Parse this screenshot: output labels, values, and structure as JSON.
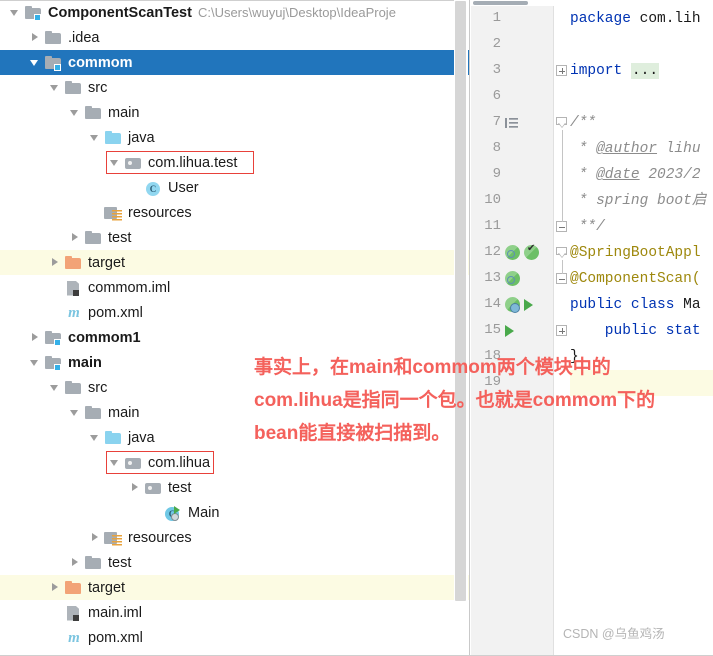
{
  "project_tree": {
    "scrollbar": {
      "visible": true
    },
    "rows": [
      {
        "indent": 0,
        "twisty": "expanded",
        "icon": "module-folder-icon",
        "label": "ComponentScanTest",
        "bold": true,
        "subpath": "C:\\Users\\wuyuj\\Desktop\\IdeaProje",
        "state": "normal",
        "name": "tree-row-componentscantest"
      },
      {
        "indent": 1,
        "twisty": "collapsed",
        "icon": "folder-icon",
        "label": ".idea",
        "bold": false,
        "subpath": "",
        "state": "normal",
        "name": "tree-row-idea"
      },
      {
        "indent": 1,
        "twisty": "expanded",
        "icon": "module-folder-icon",
        "label": "commom",
        "bold": true,
        "subpath": "",
        "state": "selected",
        "name": "tree-row-commom"
      },
      {
        "indent": 2,
        "twisty": "expanded",
        "icon": "folder-icon",
        "label": "src",
        "bold": false,
        "subpath": "",
        "state": "normal",
        "name": "tree-row-commom-src"
      },
      {
        "indent": 3,
        "twisty": "expanded",
        "icon": "folder-icon",
        "label": "main",
        "bold": false,
        "subpath": "",
        "state": "normal",
        "name": "tree-row-commom-src-main"
      },
      {
        "indent": 4,
        "twisty": "expanded",
        "icon": "source-folder-icon",
        "label": "java",
        "bold": false,
        "subpath": "",
        "state": "normal",
        "name": "tree-row-commom-java"
      },
      {
        "indent": 5,
        "twisty": "expanded",
        "icon": "package-icon",
        "label": "com.lihua.test",
        "bold": false,
        "subpath": "",
        "state": "normal",
        "name": "tree-row-package-com-lihua-test"
      },
      {
        "indent": 6,
        "twisty": "none",
        "icon": "java-class-icon",
        "label": "User",
        "bold": false,
        "subpath": "",
        "state": "normal",
        "name": "tree-row-class-user"
      },
      {
        "indent": 4,
        "twisty": "none",
        "icon": "resources-folder-icon",
        "label": "resources",
        "bold": false,
        "subpath": "",
        "state": "normal",
        "name": "tree-row-commom-resources"
      },
      {
        "indent": 3,
        "twisty": "collapsed",
        "icon": "folder-icon",
        "label": "test",
        "bold": false,
        "subpath": "",
        "state": "normal",
        "name": "tree-row-commom-test"
      },
      {
        "indent": 2,
        "twisty": "collapsed",
        "icon": "target-folder-icon",
        "label": "target",
        "bold": false,
        "subpath": "",
        "state": "excluded",
        "name": "tree-row-commom-target"
      },
      {
        "indent": 2,
        "twisty": "none",
        "icon": "iml-file-icon",
        "label": "commom.iml",
        "bold": false,
        "subpath": "",
        "state": "normal",
        "name": "tree-row-commom-iml"
      },
      {
        "indent": 2,
        "twisty": "none",
        "icon": "maven-pom-icon",
        "label": "pom.xml",
        "bold": false,
        "subpath": "",
        "state": "normal",
        "name": "tree-row-commom-pom"
      },
      {
        "indent": 1,
        "twisty": "collapsed",
        "icon": "module-folder-icon",
        "label": "commom1",
        "bold": true,
        "subpath": "",
        "state": "normal",
        "name": "tree-row-commom1"
      },
      {
        "indent": 1,
        "twisty": "expanded",
        "icon": "module-folder-icon",
        "label": "main",
        "bold": true,
        "subpath": "",
        "state": "normal",
        "name": "tree-row-main-module"
      },
      {
        "indent": 2,
        "twisty": "expanded",
        "icon": "folder-icon",
        "label": "src",
        "bold": false,
        "subpath": "",
        "state": "normal",
        "name": "tree-row-main-src"
      },
      {
        "indent": 3,
        "twisty": "expanded",
        "icon": "folder-icon",
        "label": "main",
        "bold": false,
        "subpath": "",
        "state": "normal",
        "name": "tree-row-main-src-main"
      },
      {
        "indent": 4,
        "twisty": "expanded",
        "icon": "source-folder-icon",
        "label": "java",
        "bold": false,
        "subpath": "",
        "state": "normal",
        "name": "tree-row-main-java"
      },
      {
        "indent": 5,
        "twisty": "expanded",
        "icon": "package-icon",
        "label": "com.lihua",
        "bold": false,
        "subpath": "",
        "state": "normal",
        "name": "tree-row-package-com-lihua"
      },
      {
        "indent": 6,
        "twisty": "collapsed",
        "icon": "package-icon",
        "label": "test",
        "bold": false,
        "subpath": "",
        "state": "normal",
        "name": "tree-row-package-test"
      },
      {
        "indent": 7,
        "twisty": "none",
        "icon": "java-class-run-icon",
        "label": "Main",
        "bold": false,
        "subpath": "",
        "state": "normal",
        "name": "tree-row-class-main"
      },
      {
        "indent": 4,
        "twisty": "collapsed",
        "icon": "resources-folder-icon",
        "label": "resources",
        "bold": false,
        "subpath": "",
        "state": "normal",
        "name": "tree-row-main-resources"
      },
      {
        "indent": 3,
        "twisty": "collapsed",
        "icon": "folder-icon",
        "label": "test",
        "bold": false,
        "subpath": "",
        "state": "normal",
        "name": "tree-row-main-test"
      },
      {
        "indent": 2,
        "twisty": "collapsed",
        "icon": "target-folder-icon",
        "label": "target",
        "bold": false,
        "subpath": "",
        "state": "excluded",
        "name": "tree-row-main-target"
      },
      {
        "indent": 2,
        "twisty": "none",
        "icon": "iml-file-icon",
        "label": "main.iml",
        "bold": false,
        "subpath": "",
        "state": "normal",
        "name": "tree-row-main-iml"
      },
      {
        "indent": 2,
        "twisty": "none",
        "icon": "maven-pom-icon",
        "label": "pom.xml",
        "bold": false,
        "subpath": "",
        "state": "normal",
        "name": "tree-row-main-pom"
      }
    ],
    "red_highlight_boxes": [
      {
        "target": "com.lihua.test",
        "name": "red-box-com-lihua-test"
      },
      {
        "target": "com.lihua",
        "name": "red-box-com-lihua"
      }
    ]
  },
  "editor": {
    "line_numbers": [
      "1",
      "2",
      "3",
      "6",
      "7",
      "8",
      "9",
      "10",
      "11",
      "12",
      "13",
      "14",
      "15",
      "18",
      "19"
    ],
    "lines": [
      {
        "num": "1",
        "segments": [
          {
            "t": "package",
            "c": "kw"
          },
          {
            "t": " com.lih",
            "c": "plain"
          }
        ]
      },
      {
        "num": "2",
        "segments": []
      },
      {
        "num": "3",
        "segments": [
          {
            "t": "import",
            "c": "kw"
          },
          {
            "t": " ",
            "c": "plain"
          },
          {
            "t": "...",
            "c": "fold-ellipsis"
          }
        ]
      },
      {
        "num": "6",
        "segments": []
      },
      {
        "num": "7",
        "segments": [
          {
            "t": "/**",
            "c": "cmt"
          }
        ]
      },
      {
        "num": "8",
        "segments": [
          {
            "t": " * ",
            "c": "cmt"
          },
          {
            "t": "@author",
            "c": "cmt-tag"
          },
          {
            "t": " lihu",
            "c": "cmt"
          }
        ]
      },
      {
        "num": "9",
        "segments": [
          {
            "t": " * ",
            "c": "cmt"
          },
          {
            "t": "@date",
            "c": "cmt-tag"
          },
          {
            "t": " 2023/2",
            "c": "cmt"
          }
        ]
      },
      {
        "num": "10",
        "segments": [
          {
            "t": " * spring boot启",
            "c": "cmt"
          }
        ]
      },
      {
        "num": "11",
        "segments": [
          {
            "t": " **/",
            "c": "cmt"
          }
        ]
      },
      {
        "num": "12",
        "segments": [
          {
            "t": "@SpringBootAppl",
            "c": "anno"
          }
        ]
      },
      {
        "num": "13",
        "segments": [
          {
            "t": "@ComponentScan(",
            "c": "anno"
          }
        ]
      },
      {
        "num": "14",
        "segments": [
          {
            "t": "public class ",
            "c": "kw"
          },
          {
            "t": "Ma",
            "c": "plain"
          }
        ]
      },
      {
        "num": "15",
        "segments": [
          {
            "t": "    public stat",
            "c": "kw"
          }
        ]
      },
      {
        "num": "18",
        "segments": [
          {
            "t": "}",
            "c": "plain"
          }
        ]
      },
      {
        "num": "19",
        "segments": []
      }
    ],
    "gutter_markers": [
      {
        "line": "7",
        "glyphs": [
          "indent-guide-icon"
        ]
      },
      {
        "line": "12",
        "glyphs": [
          "spring-bean-icon",
          "spring-bean-checked-icon"
        ]
      },
      {
        "line": "13",
        "glyphs": [
          "spring-bean-icon"
        ]
      },
      {
        "line": "14",
        "glyphs": [
          "spring-bean-run-icon",
          "run-arrow-icon"
        ]
      },
      {
        "line": "15",
        "glyphs": [
          "run-arrow-icon"
        ]
      }
    ],
    "horizontal_scrollbar": {
      "visible": true
    }
  },
  "annotation": {
    "lines": [
      "事实上，在main和commom两个模块中的",
      "com.lihua是指同一个包。也就是commom下的",
      "bean能直接被扫描到。"
    ],
    "color": "#f4615c"
  },
  "watermark": {
    "text": "CSDN @乌鱼鸡汤",
    "color": "#b4b4b4"
  },
  "colors": {
    "selection_blue": "#2175bc",
    "excluded_yellow": "#fcfbe3",
    "annotation_red": "#f4615c",
    "redbox_border": "#e8413a",
    "keyword_blue": "#0033b3",
    "annotation_gold": "#9e880d",
    "comment_grey": "#8c8c8c",
    "gutter_bg": "#f2f2f2"
  }
}
